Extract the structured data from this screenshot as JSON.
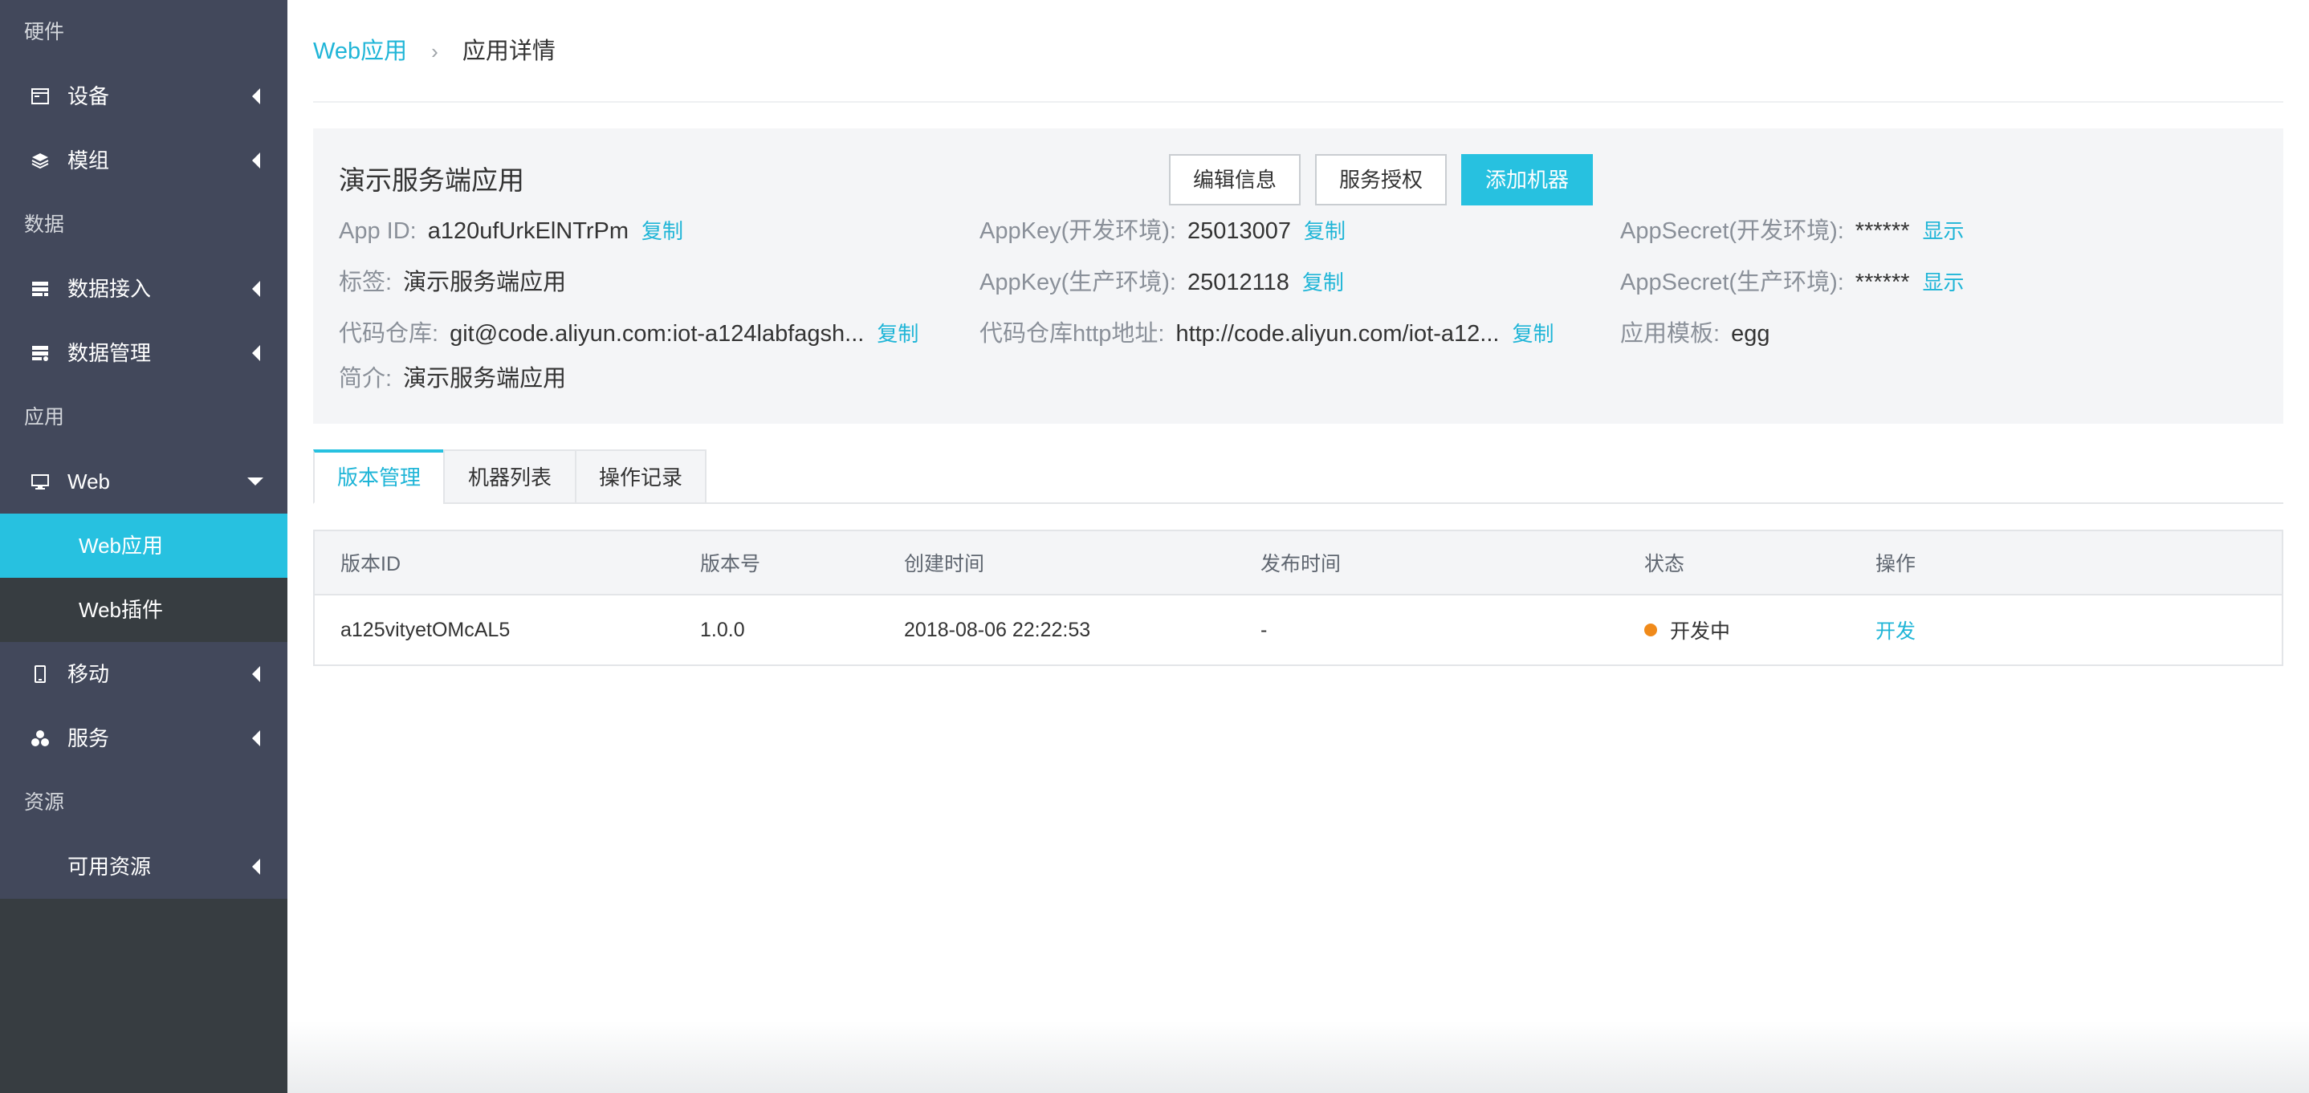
{
  "sidebar": {
    "groups": {
      "hardware": "硬件",
      "data": "数据",
      "app": "应用",
      "resource": "资源"
    },
    "items": {
      "device": "设备",
      "module": "模组",
      "data_access": "数据接入",
      "data_manage": "数据管理",
      "web": "Web",
      "web_app": "Web应用",
      "web_plugin": "Web插件",
      "mobile": "移动",
      "service": "服务",
      "available_resource": "可用资源"
    },
    "active_color": "#27c1e0"
  },
  "breadcrumb": {
    "parent": "Web应用",
    "separator": "›",
    "current": "应用详情"
  },
  "app_info": {
    "name": "演示服务端应用",
    "buttons": {
      "edit": "编辑信息",
      "authorize": "服务授权",
      "add_machine": "添加机器"
    },
    "fields": {
      "app_id_label": "App ID:",
      "app_id_value": "a120ufUrkElNTrPm",
      "appkey_dev_label": "AppKey(开发环境):",
      "appkey_dev_value": "25013007",
      "appsecret_dev_label": "AppSecret(开发环境):",
      "appsecret_dev_value": "******",
      "tag_label": "标签:",
      "tag_value": "演示服务端应用",
      "appkey_prod_label": "AppKey(生产环境):",
      "appkey_prod_value": "25012118",
      "appsecret_prod_label": "AppSecret(生产环境):",
      "appsecret_prod_value": "******",
      "repo_label": "代码仓库:",
      "repo_value": "git@code.aliyun.com:iot-a124labfagsh...",
      "repo_http_label": "代码仓库http地址:",
      "repo_http_value": "http://code.aliyun.com/iot-a12...",
      "template_label": "应用模板:",
      "template_value": "egg",
      "intro_label": "简介:",
      "intro_value": "演示服务端应用"
    },
    "links": {
      "copy": "复制",
      "show": "显示"
    }
  },
  "tabs": [
    "版本管理",
    "机器列表",
    "操作记录"
  ],
  "table": {
    "headers": [
      "版本ID",
      "版本号",
      "创建时间",
      "发布时间",
      "状态",
      "操作"
    ],
    "rows": [
      {
        "version_id": "a125vityetOMcAL5",
        "version": "1.0.0",
        "created": "2018-08-06 22:22:53",
        "published": "-",
        "status": "开发中",
        "status_color": "#f08a1a",
        "action": "开发"
      }
    ]
  }
}
